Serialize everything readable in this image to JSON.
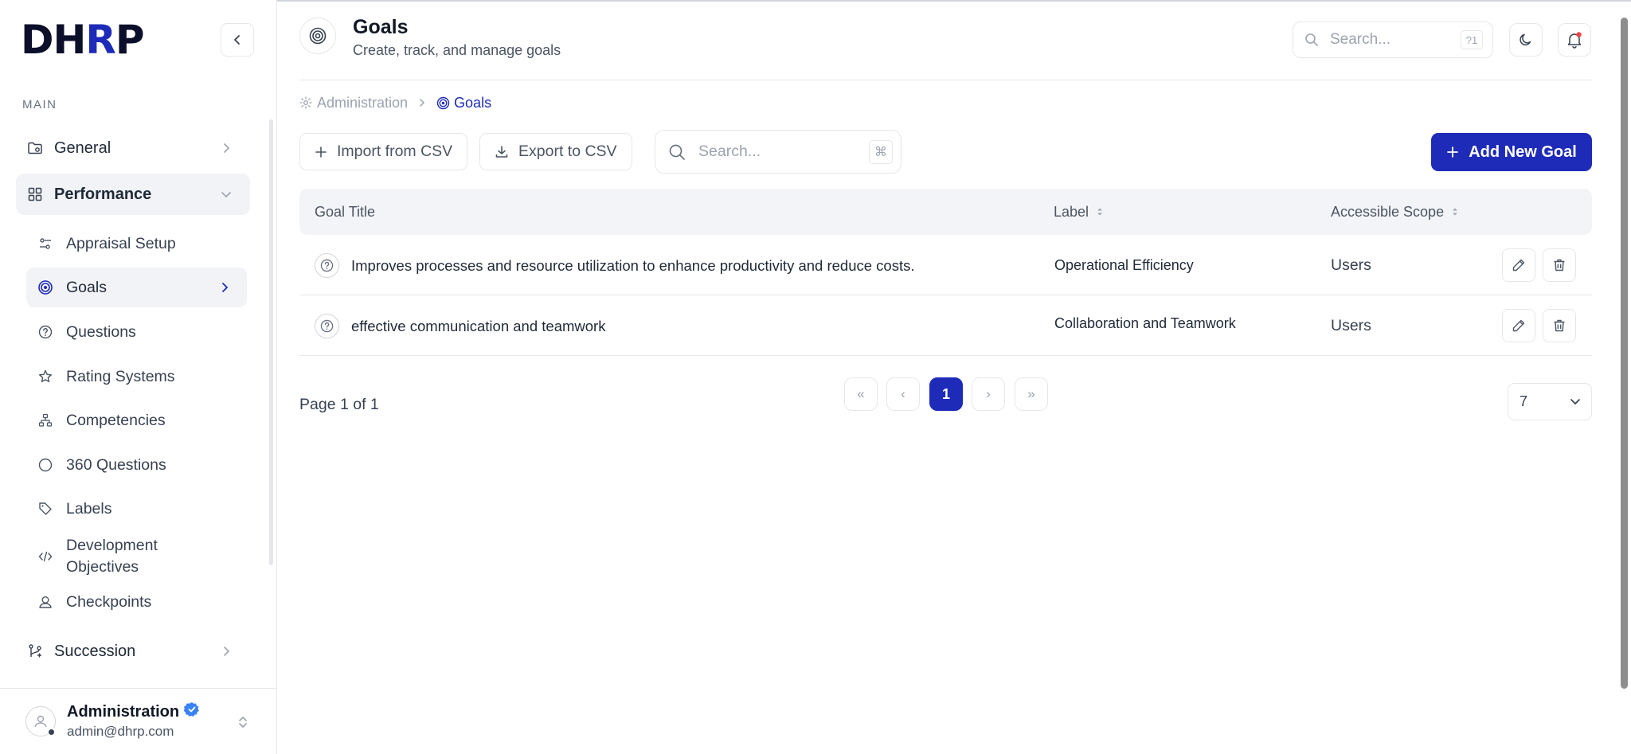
{
  "brand": {
    "logo_d": "D",
    "logo_h": "H",
    "logo_r": "R",
    "logo_p": "P"
  },
  "sidebar": {
    "section_label": "MAIN",
    "general": "General",
    "performance": "Performance",
    "sub_items": [
      {
        "label": "Appraisal Setup",
        "icon": "sliders-icon"
      },
      {
        "label": "Goals",
        "icon": "target-icon"
      },
      {
        "label": "Questions",
        "icon": "question-icon"
      },
      {
        "label": "Rating Systems",
        "icon": "star-icon"
      },
      {
        "label": "Competencies",
        "icon": "hierarchy-icon"
      },
      {
        "label": "360 Questions",
        "icon": "circle-icon"
      },
      {
        "label": "Labels",
        "icon": "tag-icon"
      },
      {
        "label": "Development Objectives",
        "icon": "code-icon"
      },
      {
        "label": "Checkpoints",
        "icon": "user-check-icon"
      }
    ],
    "succession": "Succession"
  },
  "user": {
    "name": "Administration",
    "email": "admin@dhrp.com"
  },
  "header": {
    "title": "Goals",
    "subtitle": "Create, track, and manage goals",
    "search_placeholder": "Search...",
    "search_shortcut": "?1"
  },
  "breadcrumb": {
    "parent": "Administration",
    "current": "Goals"
  },
  "toolbar": {
    "import_label": "Import from CSV",
    "export_label": "Export to CSV",
    "search_placeholder": "Search...",
    "search_shortcut": "⌘",
    "add_label": "Add New Goal"
  },
  "table": {
    "columns": {
      "title": "Goal Title",
      "label": "Label",
      "scope": "Accessible Scope"
    },
    "rows": [
      {
        "title": "Improves processes and resource utilization to enhance productivity and reduce costs.",
        "label": "Operational Efficiency",
        "scope": "Users"
      },
      {
        "title": "effective communication and teamwork",
        "label": "Collaboration and Teamwork",
        "scope": "Users"
      }
    ]
  },
  "pagination": {
    "info": "Page 1 of 1",
    "first": "«",
    "prev": "‹",
    "current": "1",
    "next": "›",
    "last": "»",
    "page_size": "7"
  },
  "colors": {
    "accent": "#1e2bb8",
    "notification_dot": "#ef4444",
    "verified": "#3b82f6"
  }
}
